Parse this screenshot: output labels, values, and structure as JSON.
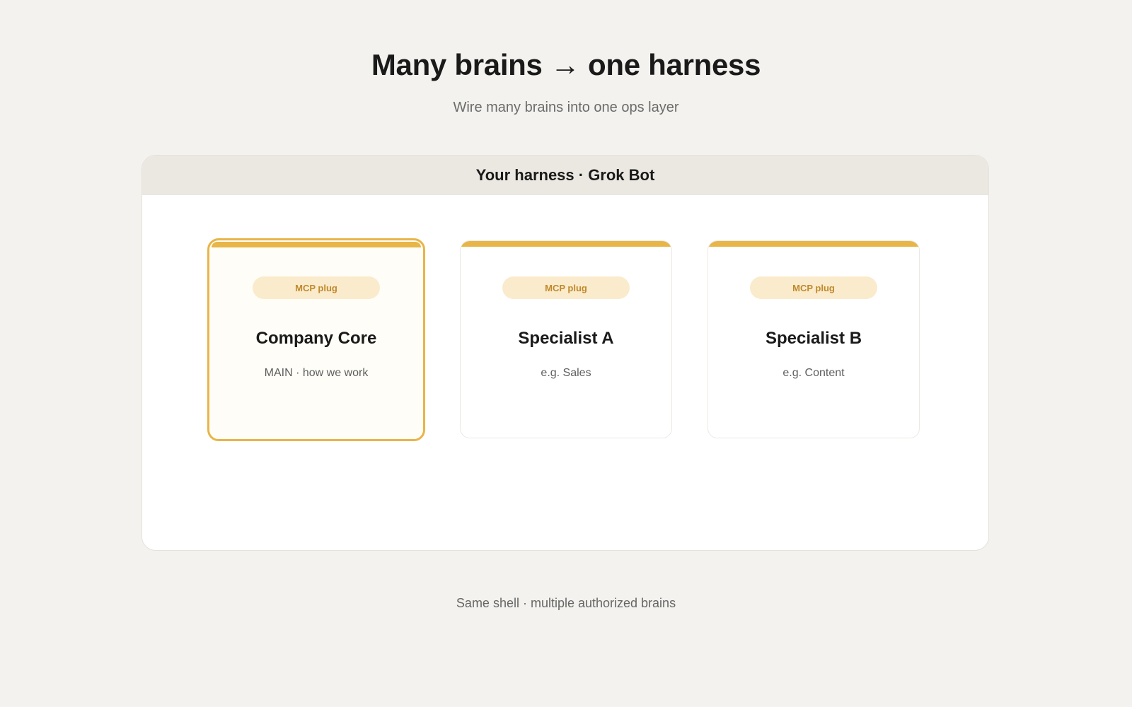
{
  "header": {
    "title": "Many brains → one harness",
    "subtitle": "Wire many brains into one ops layer"
  },
  "harness": {
    "label": "Your harness · Grok Bot",
    "brains": [
      {
        "badge": "MCP plug",
        "name": "Company Core",
        "description": "MAIN · how we work",
        "highlighted": true
      },
      {
        "badge": "MCP plug",
        "name": "Specialist A",
        "description": "e.g. Sales",
        "highlighted": false
      },
      {
        "badge": "MCP plug",
        "name": "Specialist B",
        "description": "e.g. Content",
        "highlighted": false
      }
    ]
  },
  "footer": {
    "caption": "Same shell · multiple authorized brains"
  },
  "colors": {
    "accent": "#e8b548",
    "badge_bg": "#faebcd",
    "badge_text": "#c0892a",
    "page_bg": "#f3f2ee"
  }
}
